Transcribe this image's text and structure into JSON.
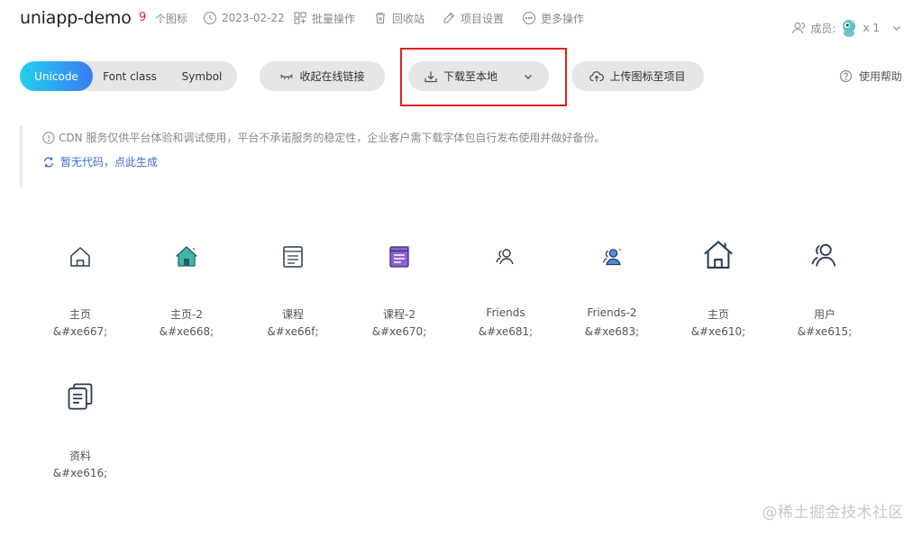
{
  "header": {
    "project_title": "uniapp-demo",
    "icon_count": "9",
    "icon_count_label": "个图标",
    "date": "2023-02-22",
    "batch_ops": "批量操作",
    "recycle_bin": "回收站",
    "project_settings": "项目设置",
    "more_ops": "更多操作",
    "members_label": "成员:",
    "members_count": "x 1"
  },
  "toolbar": {
    "tabs": [
      "Unicode",
      "Font class",
      "Symbol"
    ],
    "active_tab": "Unicode",
    "collapse_link": "收起在线链接",
    "download_local": "下载至本地",
    "upload_icons": "上传图标至项目",
    "help": "使用帮助"
  },
  "notice": {
    "cdn_text": "CDN 服务仅供平台体验和调试使用，平台不承诺服务的稳定性，企业客户需下载字体包自行发布使用并做好备份。",
    "generate_link": "暂无代码，点此生成"
  },
  "icons": [
    {
      "name": "主页",
      "code": "&#xe667;",
      "icon": "home-outline-icon"
    },
    {
      "name": "主页-2",
      "code": "&#xe668;",
      "icon": "home-filled-icon"
    },
    {
      "name": "课程",
      "code": "&#xe66f;",
      "icon": "course-outline-icon"
    },
    {
      "name": "课程-2",
      "code": "&#xe670;",
      "icon": "course-filled-icon"
    },
    {
      "name": "Friends",
      "code": "&#xe681;",
      "icon": "friends-outline-icon"
    },
    {
      "name": "Friends-2",
      "code": "&#xe683;",
      "icon": "friends-filled-icon"
    },
    {
      "name": "主页",
      "code": "&#xe610;",
      "icon": "home-large-icon"
    },
    {
      "name": "用户",
      "code": "&#xe615;",
      "icon": "user-icon"
    },
    {
      "name": "资料",
      "code": "&#xe616;",
      "icon": "documents-icon"
    }
  ],
  "colors": {
    "accent_start": "#22d1ee",
    "accent_end": "#3a7bf0",
    "highlight_box": "#e0201f",
    "count_red": "#e8202c",
    "link_blue": "#3a6ad4"
  },
  "watermark": "@稀土掘金技术社区"
}
